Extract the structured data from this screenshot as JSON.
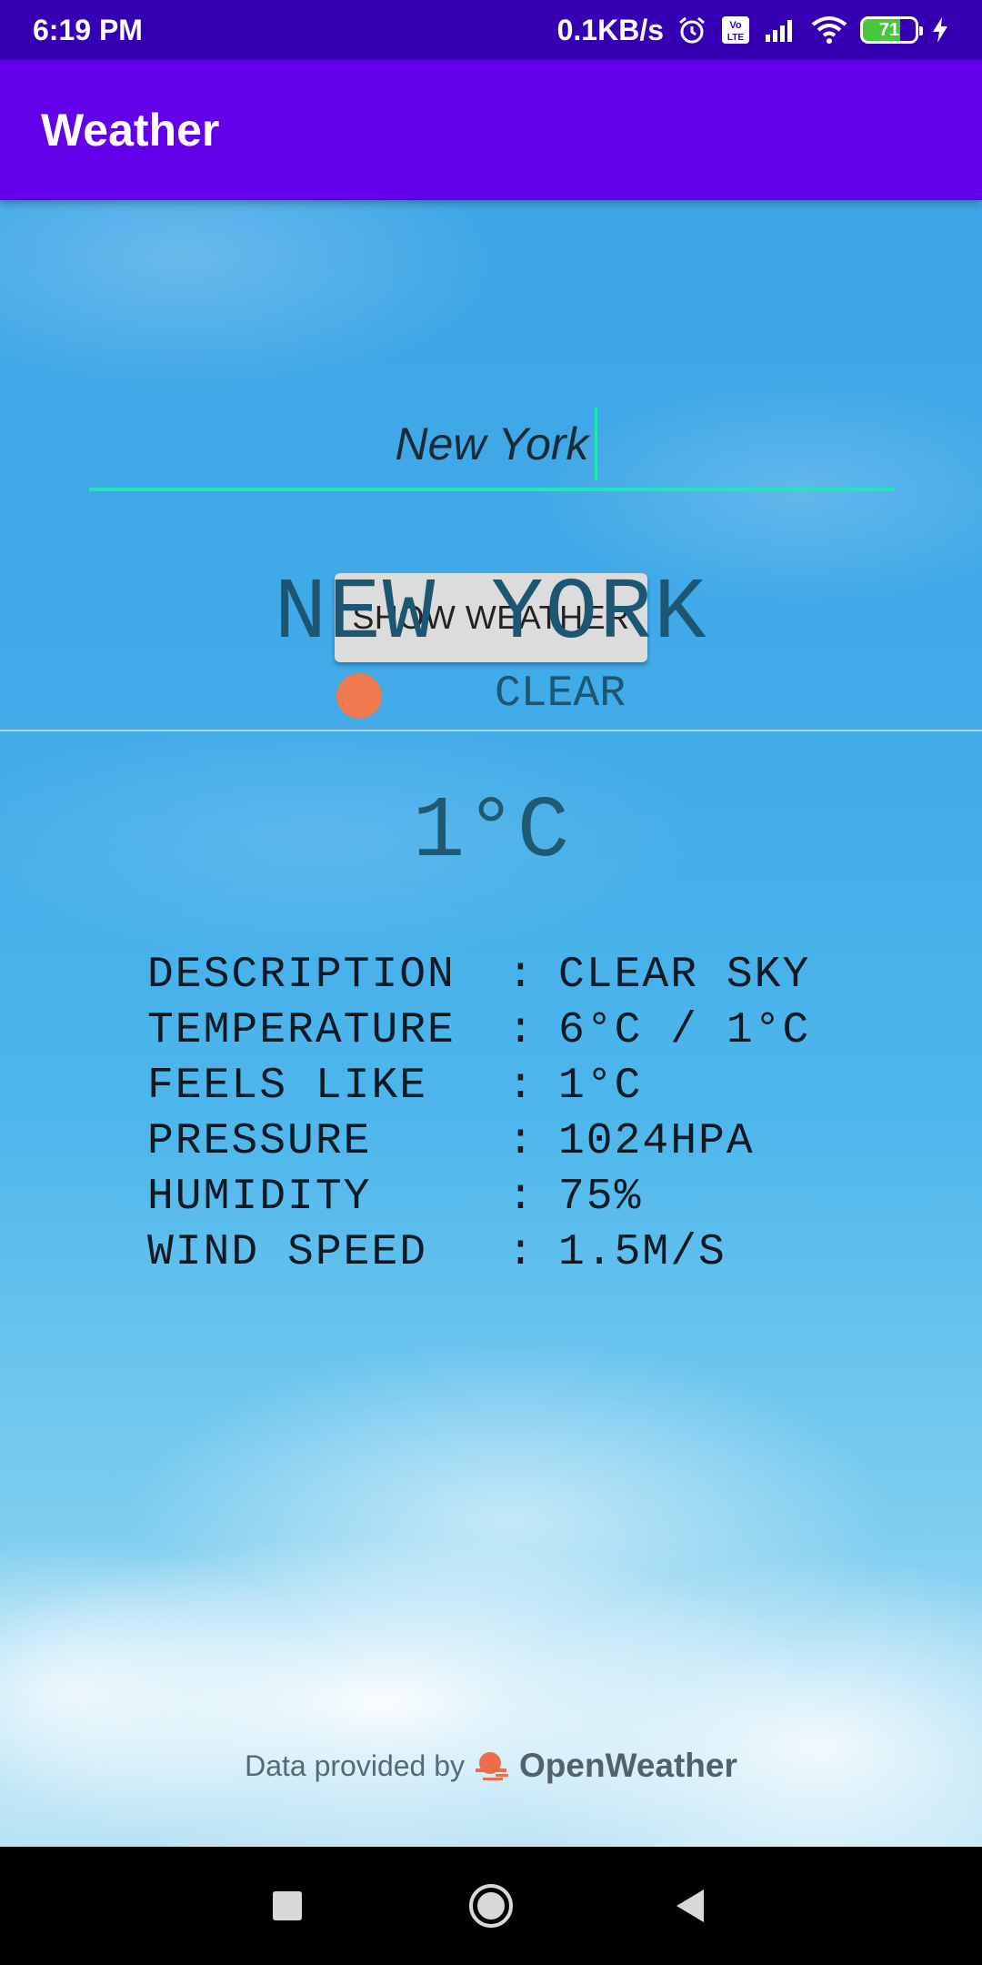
{
  "status_bar": {
    "time": "6:19 PM",
    "network_speed": "0.1KB/s",
    "battery_level": "71",
    "icons": [
      "alarm-icon",
      "volte-icon",
      "signal-icon",
      "wifi-icon",
      "battery-icon",
      "charging-icon"
    ]
  },
  "app_bar": {
    "title": "Weather"
  },
  "search": {
    "value": "New York",
    "button_label": "SHOW WEATHER"
  },
  "weather": {
    "city": "NEW YORK",
    "condition": "CLEAR",
    "condition_icon": "sun-icon",
    "temperature": "1°C",
    "details": [
      {
        "label": "DESCRIPTION",
        "sep": ":",
        "value": "CLEAR SKY"
      },
      {
        "label": "TEMPERATURE",
        "sep": ":",
        "value": "6°C / 1°C"
      },
      {
        "label": "FEELS LIKE",
        "sep": ":",
        "value": "1°C"
      },
      {
        "label": "PRESSURE",
        "sep": ":",
        "value": "1024HPA"
      },
      {
        "label": "HUMIDITY",
        "sep": ":",
        "value": "75%"
      },
      {
        "label": "WIND SPEED",
        "sep": ":",
        "value": "1.5M/S"
      }
    ]
  },
  "footer": {
    "credit_prefix": "Data provided by",
    "brand": "OpenWeather"
  },
  "colors": {
    "status_bar": "#3500b3",
    "app_bar": "#6200ea",
    "accent": "#1de9b6",
    "sun": "#f07a50",
    "city_text": "#1d5673"
  },
  "nav_bar": {
    "buttons": [
      "recents-square-icon",
      "home-circle-icon",
      "back-triangle-icon"
    ]
  }
}
